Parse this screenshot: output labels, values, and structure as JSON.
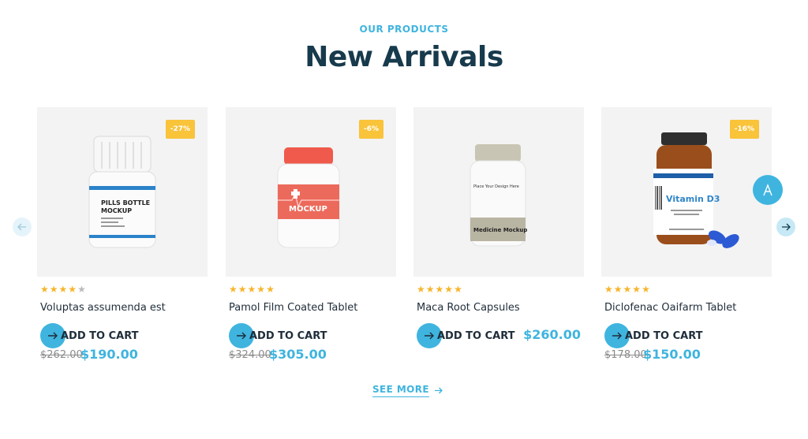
{
  "section": {
    "eyebrow": "OUR PRODUCTS",
    "title": "New Arrivals"
  },
  "colors": {
    "accent": "#3fb4df",
    "badge": "#f9c33a",
    "title": "#173a4c",
    "star": "#f7b52c"
  },
  "products": [
    {
      "title": "Voluptas assumenda est",
      "badge": "-27%",
      "rating": 4.5,
      "cart_label": "ADD TO CART",
      "old_price": "$262.00",
      "price": "$190.00",
      "image_icon": "pills-bottle-image",
      "image_text_1": "PILLS BOTTLE",
      "image_text_2": "MOCKUP"
    },
    {
      "title": "Pamol Film Coated Tablet",
      "badge": "-6%",
      "rating": 5,
      "cart_label": "ADD TO CART",
      "old_price": "$324.00",
      "price": "$305.00",
      "image_icon": "red-bottle-image",
      "image_text_1": "MOCKUP"
    },
    {
      "title": "Maca Root Capsules",
      "rating": 5,
      "cart_label": "ADD TO CART",
      "price": "$260.00",
      "image_icon": "white-bottle-image",
      "image_text_1": "Place Your Design Here",
      "image_text_2": "Medicine Mockup"
    },
    {
      "title": "Diclofenac Oaifarm Tablet",
      "badge": "-16%",
      "rating": 5,
      "cart_label": "ADD TO CART",
      "old_price": "$178.00",
      "price": "$150.00",
      "image_icon": "amber-bottle-image",
      "image_text_1": "Vitamin D3"
    }
  ],
  "navigation": {
    "prev_icon": "arrow-left-icon",
    "next_icon": "arrow-right-icon",
    "scroll_top_icon": "scroll-top-icon"
  },
  "see_more": {
    "label": "SEE MORE",
    "icon": "arrow-right-icon"
  }
}
